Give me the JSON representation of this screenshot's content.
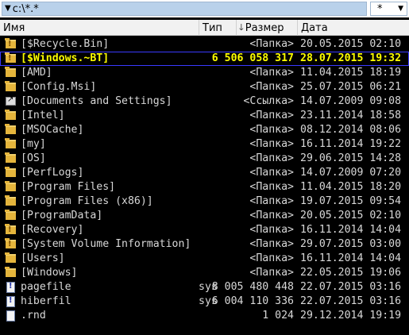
{
  "path_bar": {
    "path": "c:\\*.*",
    "filter": "*"
  },
  "columns": {
    "name": "Имя",
    "type": "Тип",
    "size": "Размер",
    "date": "Дата"
  },
  "rows": [
    {
      "name": "[$Recycle.Bin]",
      "type": "",
      "size": "<Папка>",
      "date": "20.05.2015 02:10",
      "icon": "folder-lock-icon"
    },
    {
      "name": "[$Windows.~BT]",
      "type": "",
      "size": "6 506 058 317",
      "date": "28.07.2015 19:32",
      "icon": "folder-lock-icon"
    },
    {
      "name": "[AMD]",
      "type": "",
      "size": "<Папка>",
      "date": "11.04.2015 18:19",
      "icon": "folder-icon"
    },
    {
      "name": "[Config.Msi]",
      "type": "",
      "size": "<Папка>",
      "date": "25.07.2015 06:21",
      "icon": "folder-icon"
    },
    {
      "name": "[Documents and Settings]",
      "type": "",
      "size": "<Ссылка>",
      "date": "14.07.2009 09:08",
      "icon": "link-icon"
    },
    {
      "name": "[Intel]",
      "type": "",
      "size": "<Папка>",
      "date": "23.11.2014 18:58",
      "icon": "folder-icon"
    },
    {
      "name": "[MSOCache]",
      "type": "",
      "size": "<Папка>",
      "date": "08.12.2014 08:06",
      "icon": "folder-icon"
    },
    {
      "name": "[my]",
      "type": "",
      "size": "<Папка>",
      "date": "16.11.2014 19:22",
      "icon": "folder-icon"
    },
    {
      "name": "[OS]",
      "type": "",
      "size": "<Папка>",
      "date": "29.06.2015 14:28",
      "icon": "folder-icon"
    },
    {
      "name": "[PerfLogs]",
      "type": "",
      "size": "<Папка>",
      "date": "14.07.2009 07:20",
      "icon": "folder-icon"
    },
    {
      "name": "[Program Files]",
      "type": "",
      "size": "<Папка>",
      "date": "11.04.2015 18:20",
      "icon": "folder-icon"
    },
    {
      "name": "[Program Files (x86)]",
      "type": "",
      "size": "<Папка>",
      "date": "19.07.2015 09:54",
      "icon": "folder-icon"
    },
    {
      "name": "[ProgramData]",
      "type": "",
      "size": "<Папка>",
      "date": "20.05.2015 02:10",
      "icon": "folder-icon"
    },
    {
      "name": "[Recovery]",
      "type": "",
      "size": "<Папка>",
      "date": "16.11.2014 14:04",
      "icon": "folder-lock-icon"
    },
    {
      "name": "[System Volume Information]",
      "type": "",
      "size": "<Папка>",
      "date": "29.07.2015 03:00",
      "icon": "folder-lock-icon"
    },
    {
      "name": "[Users]",
      "type": "",
      "size": "<Папка>",
      "date": "16.11.2014 14:04",
      "icon": "folder-icon"
    },
    {
      "name": "[Windows]",
      "type": "",
      "size": "<Папка>",
      "date": "22.05.2015 19:06",
      "icon": "folder-icon"
    },
    {
      "name": "pagefile",
      "type": "sys",
      "size": "8 005 480 448",
      "date": "22.07.2015 03:16",
      "icon": "system-file-icon"
    },
    {
      "name": "hiberfil",
      "type": "sys",
      "size": "6 004 110 336",
      "date": "22.07.2015 03:16",
      "icon": "system-file-icon"
    },
    {
      "name": ".rnd",
      "type": "",
      "size": "1 024",
      "date": "29.12.2014 19:19",
      "icon": "file-icon"
    }
  ],
  "colors": {
    "selected_text": "#ffff00",
    "normal_text": "#d8d8d8",
    "background": "#000000",
    "path_field": "#b9d1ea"
  }
}
